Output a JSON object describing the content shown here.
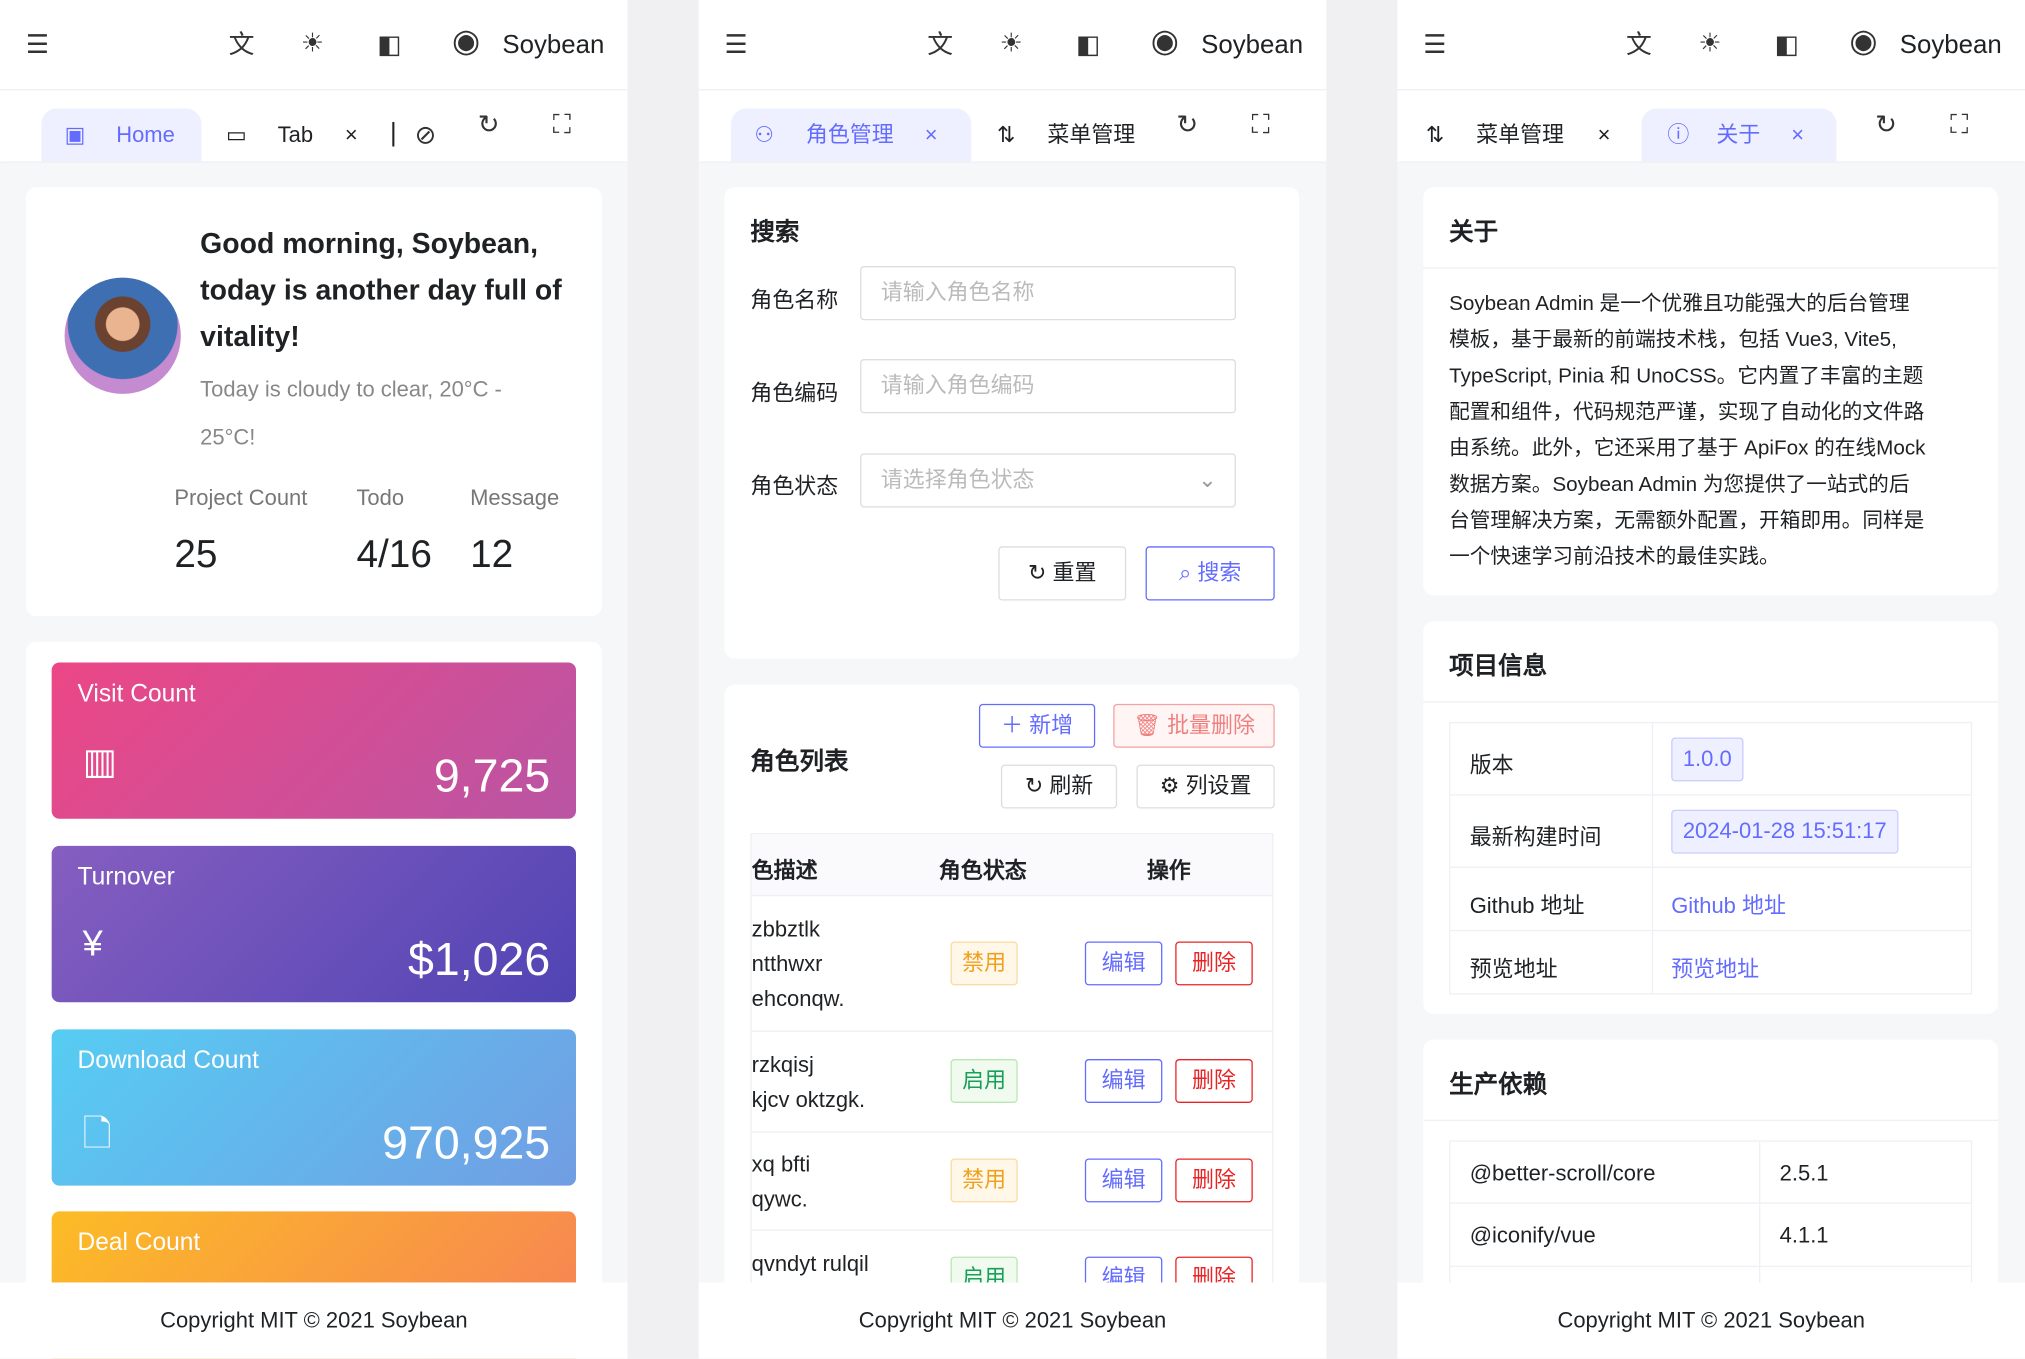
{
  "header": {
    "user": "Soybean",
    "icons": [
      "menu-fold-icon",
      "translate-icon",
      "sun-icon",
      "theme-icon",
      "user-circle-icon"
    ]
  },
  "footer": "Copyright MIT © 2021 Soybean",
  "colors": {
    "accent": "#646cff",
    "danger": "#e82424",
    "warning": "#f0a020",
    "success": "#18a058"
  },
  "panel1": {
    "tabs": [
      {
        "label": "Home",
        "active": true
      },
      {
        "label": "Tab",
        "active": false
      }
    ],
    "greeting": [
      "Good morning, Soybean,",
      "today is another day full of",
      "vitality!"
    ],
    "weather": [
      "Today is cloudy to clear, 20°C -",
      "25°C!"
    ],
    "stats": [
      {
        "label": "Project Count",
        "value": "25"
      },
      {
        "label": "Todo",
        "value": "4/16"
      },
      {
        "label": "Message",
        "value": "12"
      }
    ],
    "cards": [
      {
        "title": "Visit Count",
        "value": "9,725"
      },
      {
        "title": "Turnover",
        "value": "$1,026"
      },
      {
        "title": "Download Count",
        "value": "970,925"
      },
      {
        "title": "Deal Count",
        "value": ""
      }
    ]
  },
  "panel2": {
    "tabs": [
      {
        "label": "角色管理",
        "active": true
      },
      {
        "label": "菜单管理",
        "active": false
      }
    ],
    "search": {
      "title": "搜索",
      "fields": [
        {
          "label": "角色名称",
          "placeholder": "请输入角色名称"
        },
        {
          "label": "角色编码",
          "placeholder": "请输入角色编码"
        },
        {
          "label": "角色状态",
          "placeholder": "请选择角色状态"
        }
      ],
      "reset": "重置",
      "submit": "搜索"
    },
    "list": {
      "title": "角色列表",
      "add": "新增",
      "batch_delete": "批量删除",
      "refresh": "刷新",
      "columns_setting": "列设置",
      "headers": [
        "色描述",
        "角色状态",
        "操作"
      ],
      "rows": [
        {
          "desc": [
            "zbbztlk",
            "ntthwxr",
            "ehconqw."
          ],
          "status": "禁用",
          "edit": "编辑",
          "delete": "删除"
        },
        {
          "desc": [
            "rzkqisj",
            "kjcv oktzgk."
          ],
          "status": "启用",
          "edit": "编辑",
          "delete": "删除"
        },
        {
          "desc": [
            "xq bfti",
            "qywc."
          ],
          "status": "禁用",
          "edit": "编辑",
          "delete": "删除"
        },
        {
          "desc": [
            "qvndyt rulqil"
          ],
          "status": "启用",
          "edit": "编辑",
          "delete": "删除"
        }
      ]
    }
  },
  "panel3": {
    "tabs": [
      {
        "label": "菜单管理",
        "active": false
      },
      {
        "label": "关于",
        "active": true
      }
    ],
    "about": {
      "title": "关于",
      "lines": [
        "Soybean Admin 是一个优雅且功能强大的后台管理",
        "模板，基于最新的前端技术栈，包括 Vue3, Vite5,",
        "TypeScript, Pinia 和 UnoCSS。它内置了丰富的主题",
        "配置和组件，代码规范严谨，实现了自动化的文件路",
        "由系统。此外，它还采用了基于 ApiFox 的在线Mock",
        "数据方案。Soybean Admin 为您提供了一站式的后",
        "台管理解决方案，无需额外配置，开箱即用。同样是",
        "一个快速学习前沿技术的最佳实践。"
      ]
    },
    "project": {
      "title": "项目信息",
      "rows": [
        {
          "k": "版本",
          "v": "1.0.0"
        },
        {
          "k": "最新构建时间",
          "v": "2024-01-28 15:51:17"
        },
        {
          "k": "Github 地址",
          "v": "Github 地址"
        },
        {
          "k": "预览地址",
          "v": "预览地址"
        }
      ]
    },
    "deps": {
      "title": "生产依赖",
      "rows": [
        {
          "k": "@better-scroll/core",
          "v": "2.5.1"
        },
        {
          "k": "@iconify/vue",
          "v": "4.1.1"
        }
      ]
    }
  }
}
